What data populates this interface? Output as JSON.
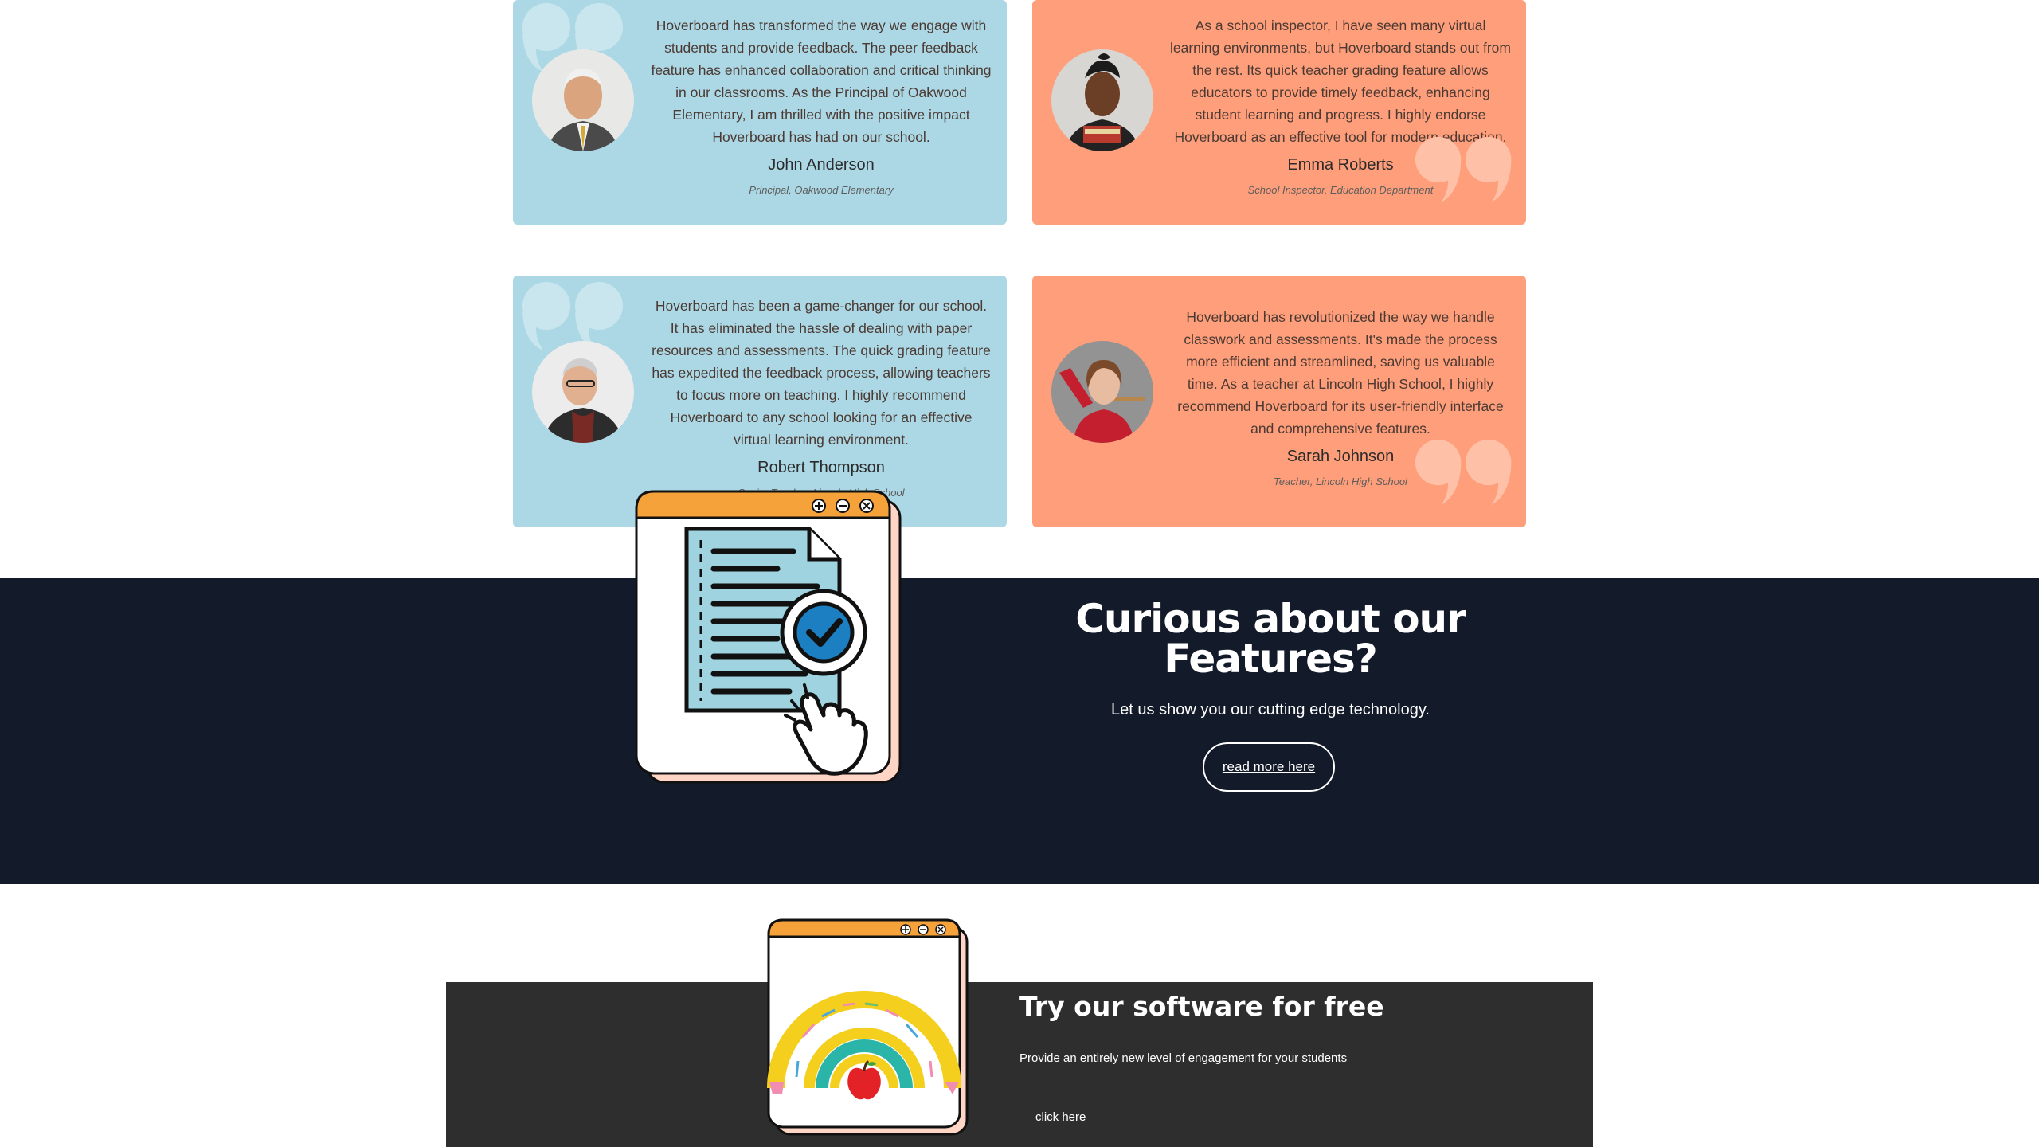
{
  "testimonials": [
    {
      "quote": "Hoverboard has transformed the way we engage with students and provide feedback. The peer feedback feature has enhanced collaboration and critical thinking in our classrooms. As the Principal of Oakwood Elementary, I am thrilled with the positive impact Hoverboard has had on our school.",
      "name": "John Anderson",
      "role": "Principal, Oakwood Elementary"
    },
    {
      "quote": "As a school inspector, I have seen many virtual learning environments, but Hoverboard stands out from the rest. Its quick teacher grading feature allows educators to provide timely feedback, enhancing student learning and progress. I highly endorse Hoverboard as an effective tool for modern education.",
      "name": "Emma Roberts",
      "role": "School Inspector, Education Department"
    },
    {
      "quote": "Hoverboard has been a game-changer for our school. It has eliminated the hassle of dealing with paper resources and assessments. The quick grading feature has expedited the feedback process, allowing teachers to focus more on teaching. I highly recommend Hoverboard to any school looking for an effective virtual learning environment.",
      "name": "Robert Thompson",
      "role": "Senior Teacher, Lincoln High School"
    },
    {
      "quote": "Hoverboard has revolutionized the way we handle classwork and assessments. It's made the process more efficient and streamlined, saving us valuable time. As a teacher at Lincoln High School, I highly recommend Hoverboard for its user-friendly interface and comprehensive features.",
      "name": "Sarah Johnson",
      "role": "Teacher, Lincoln High School"
    }
  ],
  "features": {
    "title": "Curious about our Features?",
    "subtitle": "Let us show you our cutting edge technology.",
    "button": "read more here"
  },
  "promo": {
    "title": "Try our software for free",
    "subtitle": "Provide an entirely new level of engagement for your students",
    "link": "click here"
  },
  "colors": {
    "card_blue": "#acd8e5",
    "card_salmon": "#ff9e7a",
    "band_dark": "#131a29",
    "promo_dark": "#2e2e2e",
    "window_orange": "#f6a23a"
  },
  "icons": [
    "quote-icon",
    "window-plus-icon",
    "window-minus-icon",
    "window-close-icon",
    "document-check-icon",
    "hand-pointer-icon",
    "rainbow-ruler-icon",
    "apple-icon"
  ]
}
